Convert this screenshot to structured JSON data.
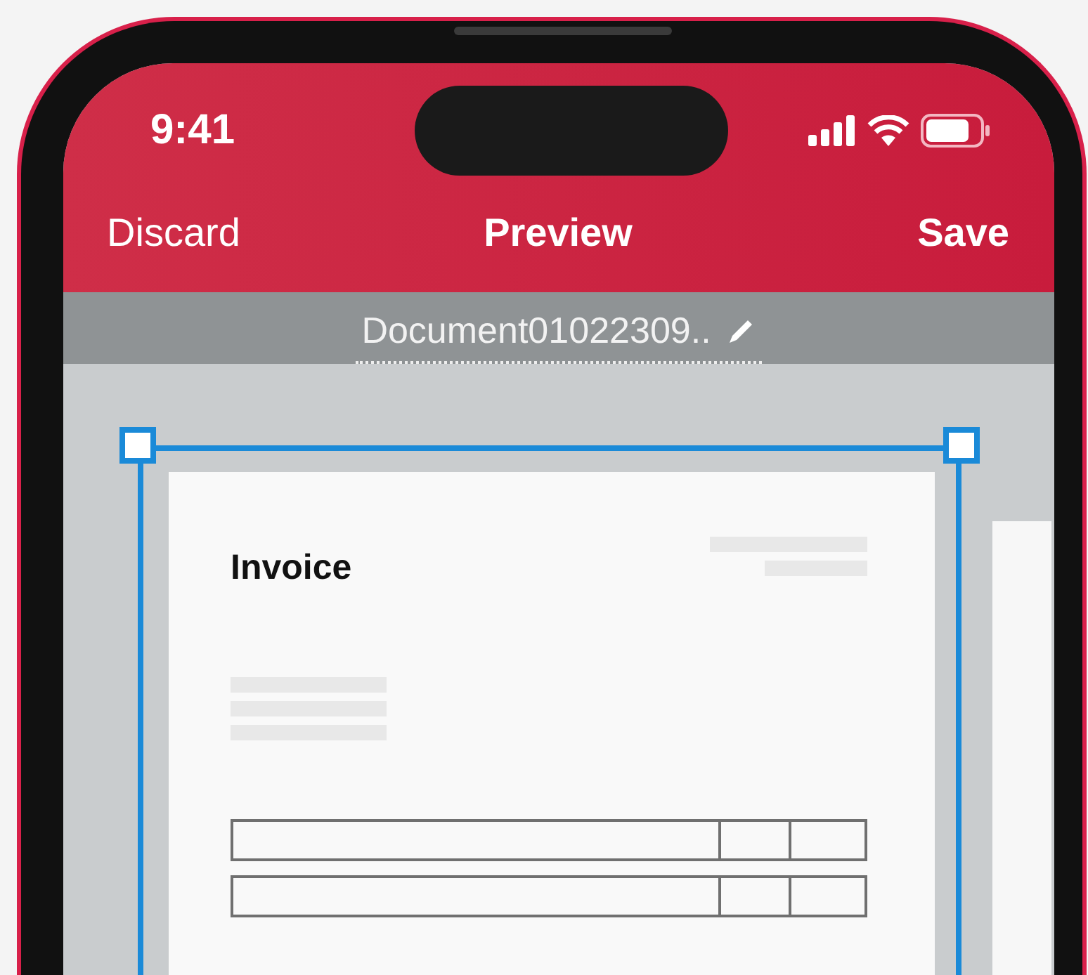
{
  "status_bar": {
    "time": "9:41"
  },
  "nav_bar": {
    "left_action": "Discard",
    "title": "Preview",
    "right_action": "Save"
  },
  "file_name": {
    "value": "Document01022309.."
  },
  "document": {
    "heading": "Invoice"
  }
}
